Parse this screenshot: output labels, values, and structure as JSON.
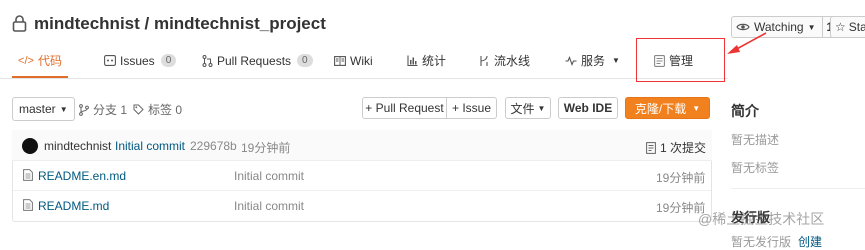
{
  "header": {
    "repo_title": "mindtechnist / mindtechnist_project",
    "watch_label": "Watching",
    "watch_count": "1",
    "star_label": "Star"
  },
  "nav": {
    "tabs": [
      {
        "label": "代码",
        "icon": "code-icon"
      },
      {
        "label": "Issues",
        "icon": "issue-icon",
        "badge": "0"
      },
      {
        "label": "Pull Requests",
        "icon": "pull-request-icon",
        "badge": "0"
      },
      {
        "label": "Wiki",
        "icon": "book-icon"
      },
      {
        "label": "统计",
        "icon": "bar-chart-icon"
      },
      {
        "label": "流水线",
        "icon": "pipeline-icon"
      },
      {
        "label": "服务",
        "icon": "pulse-icon"
      },
      {
        "label": "管理",
        "icon": "manage-icon"
      }
    ]
  },
  "toolbar": {
    "branch": "master",
    "branches": "分支 1",
    "tags": "标签 0",
    "pull_request_btn": "+ Pull Request",
    "issue_btn": "+ Issue",
    "file_btn": "文件",
    "web_ide_btn": "Web IDE",
    "clone_btn": "克隆/下载"
  },
  "commit": {
    "author": "mindtechnist",
    "message": "Initial commit",
    "hash": "229678b",
    "time": "19分钟前",
    "count": "1 次提交"
  },
  "files": [
    {
      "name": "README.en.md",
      "message": "Initial commit",
      "time": "19分钟前"
    },
    {
      "name": "README.md",
      "message": "Initial commit",
      "time": "19分钟前"
    }
  ],
  "sidebar": {
    "intro_title": "简介",
    "no_desc": "暂无描述",
    "no_tags": "暂无标签",
    "release_title": "发行版",
    "no_release": "暂无发行版",
    "create": "创建"
  },
  "watermark": "@稀土掘金技术社区",
  "colors": {
    "accent": "#e16d2b",
    "orange_button": "#f0811e",
    "highlight_box": "#ee3333",
    "link": "#005980"
  }
}
